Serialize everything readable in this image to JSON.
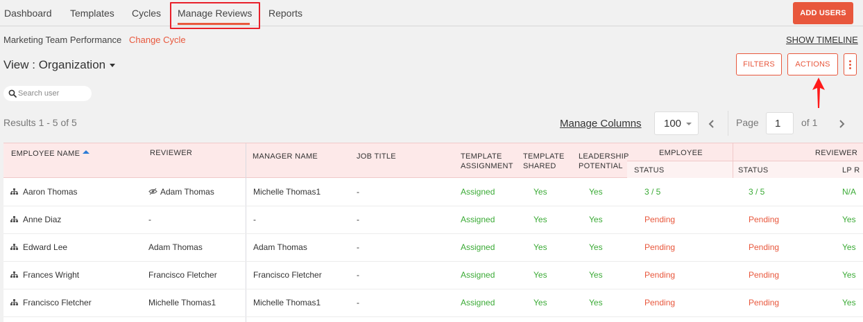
{
  "nav": {
    "tabs": [
      {
        "label": "Dashboard"
      },
      {
        "label": "Templates"
      },
      {
        "label": "Cycles"
      },
      {
        "label": "Manage Reviews"
      },
      {
        "label": "Reports"
      }
    ],
    "active_index": 3,
    "add_users_label": "ADD USERS"
  },
  "cycle": {
    "name": "Marketing Team Performance",
    "change_label": "Change Cycle",
    "timeline_label": "SHOW TIMELINE"
  },
  "view": {
    "label": "View : Organization",
    "filters_label": "FILTERS",
    "actions_label": "ACTIONS"
  },
  "search": {
    "placeholder": "Search user",
    "value": ""
  },
  "results": {
    "text": "Results 1 - 5 of 5",
    "manage_columns_label": "Manage Columns",
    "per_page": "100",
    "page_label": "Page",
    "page_value": "1",
    "of_label": "of 1"
  },
  "table": {
    "headers": {
      "employee_name": "EMPLOYEE NAME",
      "reviewer": "REVIEWER",
      "manager_name": "MANAGER NAME",
      "job_title": "JOB TITLE",
      "template_assignment_1": "TEMPLATE",
      "template_assignment_2": "ASSIGNMENT",
      "template_shared_1": "TEMPLATE",
      "template_shared_2": "SHARED",
      "leadership_1": "LEADERSHIP",
      "leadership_2": "POTENTIAL",
      "employee_group": "EMPLOYEE",
      "employee_status": "STATUS",
      "reviewer_group": "REVIEWER",
      "reviewer_status": "STATUS",
      "reviewer_lp": "LP R"
    },
    "rows": [
      {
        "employee": "Aaron Thomas",
        "reviewer": "Adam Thomas",
        "manager": "Michelle Thomas1",
        "job_title": "-",
        "assignment": "Assigned",
        "shared": "Yes",
        "leadership": "Yes",
        "emp_status": "3 / 5",
        "rev_status": "3 / 5",
        "lp": "N/A",
        "has_view_icon": true
      },
      {
        "employee": "Anne Diaz",
        "reviewer": "-",
        "manager": "-",
        "job_title": "-",
        "assignment": "Assigned",
        "shared": "Yes",
        "leadership": "Yes",
        "emp_status": "Pending",
        "rev_status": "Pending",
        "lp": "Yes"
      },
      {
        "employee": "Edward Lee",
        "reviewer": "Adam Thomas",
        "manager": "Adam Thomas",
        "job_title": "-",
        "assignment": "Assigned",
        "shared": "Yes",
        "leadership": "Yes",
        "emp_status": "Pending",
        "rev_status": "Pending",
        "lp": "Yes"
      },
      {
        "employee": "Frances Wright",
        "reviewer": "Francisco Fletcher",
        "manager": "Francisco Fletcher",
        "job_title": "-",
        "assignment": "Assigned",
        "shared": "Yes",
        "leadership": "Yes",
        "emp_status": "Pending",
        "rev_status": "Pending",
        "lp": "Yes"
      },
      {
        "employee": "Francisco Fletcher",
        "reviewer": "Michelle Thomas1",
        "manager": "Michelle Thomas1",
        "job_title": "-",
        "assignment": "Assigned",
        "shared": "Yes",
        "leadership": "Yes",
        "emp_status": "Pending",
        "rev_status": "Pending",
        "lp": "Yes"
      }
    ]
  },
  "colors": {
    "accent": "#e8573c",
    "status_green": "#3aaa35",
    "header_bg": "#fde9e9",
    "annotation_red": "#e8202a"
  },
  "icons": {
    "search": "search-icon",
    "org": "org-chart-icon",
    "view": "eye-slash-icon",
    "arrow": "red-arrow-annotation"
  }
}
